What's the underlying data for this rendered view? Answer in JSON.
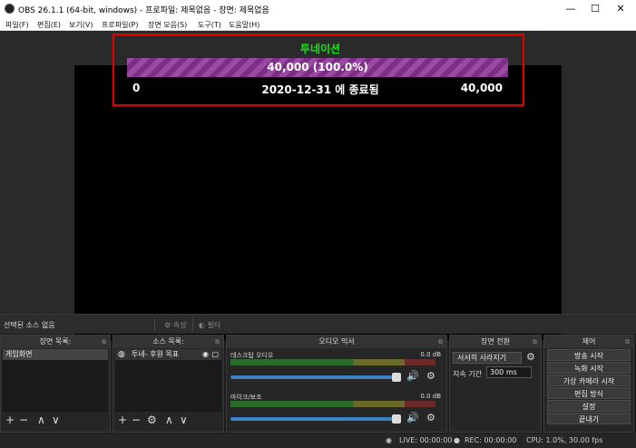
{
  "window": {
    "title": "OBS 26.1.1 (64-bit, windows) - 프로파일: 제목없음 - 장면: 제목없음"
  },
  "menu": [
    "파일(F)",
    "편집(E)",
    "보기(V)",
    "프로파일(P)",
    "장면 모음(S)",
    "도구(T)",
    "도움말(H)"
  ],
  "goal": {
    "title": "투네이션",
    "value_text": "40,000 (100.0%)",
    "progress": 1.0,
    "min": "0",
    "end_text": "2020-12-31 에 종료됨",
    "max": "40,000"
  },
  "source_toolbar": {
    "no_source": "선택된 소스 없음",
    "properties": "속성",
    "filters": "필터"
  },
  "scenes": {
    "header": "장면 목록:",
    "items": [
      "게임화면"
    ]
  },
  "sources": {
    "header": "소스 목록:",
    "items": [
      "투네- 후원 목표"
    ]
  },
  "mixer": {
    "header": "오디오 믹서",
    "channels": [
      {
        "name": "데스크탑 오디오",
        "db": "0.0 dB"
      },
      {
        "name": "마이크/보조",
        "db": "0.0 dB"
      }
    ]
  },
  "transitions": {
    "header": "장면 전환",
    "type": "서서히 사라지기",
    "duration_label": "지속 기간",
    "duration": "300 ms"
  },
  "controls": {
    "header": "제어",
    "buttons": [
      "방송 시작",
      "녹화 시작",
      "가상 카메라 시작",
      "편집 방식",
      "설정",
      "끝내기"
    ]
  },
  "status": {
    "live": "LIVE: 00:00:00",
    "rec": "REC: 00:00:00",
    "cpu": "CPU: 1.0%, 30.00 fps"
  },
  "colors": {
    "goal_title": "#19e019",
    "highlight": "#e60000",
    "bar_purple": "#9a4aa3"
  }
}
